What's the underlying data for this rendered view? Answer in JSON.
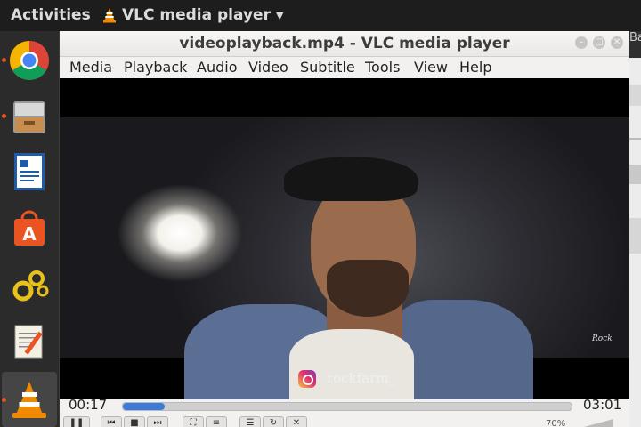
{
  "topbar": {
    "activities": "Activities",
    "app_name": "VLC media player"
  },
  "dock": {
    "items": [
      "chrome-icon",
      "files-icon",
      "writer-icon",
      "software-center-icon",
      "settings-icon",
      "text-editor-icon",
      "vlc-icon"
    ]
  },
  "vlc": {
    "title": "videoplayback.mp4 - VLC media player",
    "menu": [
      "Media",
      "Playback",
      "Audio",
      "Video",
      "Subtitle",
      "Tools",
      "View",
      "Help"
    ],
    "video": {
      "watermark": "Rock",
      "instagram_handle": "rockfarm_"
    },
    "controls": {
      "elapsed": "00:17",
      "total": "03:01",
      "progress": 0.094,
      "volume": "70%"
    }
  },
  "background_window": {
    "title_fragment": "Ba"
  },
  "colors": {
    "accent": "#3d7bd8",
    "dock_dot": "#e95420"
  }
}
